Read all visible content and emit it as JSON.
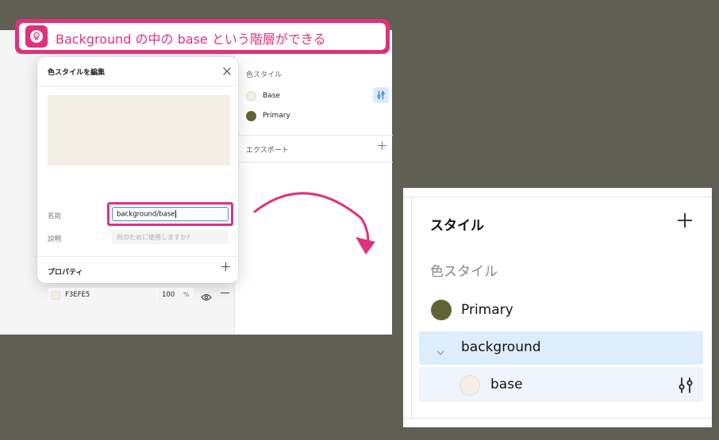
{
  "banner": {
    "text": "Background の中の base という階層ができる",
    "accent": "#e0317c",
    "icon": "lightbulb-icon"
  },
  "right_panel": {
    "section_title": "色スタイル",
    "styles": [
      {
        "label": "Base",
        "color": "#f3efe5"
      },
      {
        "label": "Primary",
        "color": "#626234"
      }
    ],
    "export_label": "エクスポート",
    "adjust_icon": "adjust-icon",
    "add_icon": "plus-icon"
  },
  "dialog": {
    "title": "色スタイルを編集",
    "close_icon": "close-icon",
    "preview_color": "#f3efe5",
    "name_label": "名前",
    "name_value": "background/base",
    "description_label": "説明",
    "description_placeholder": "何のために使用しますか?",
    "properties_title": "プロパティ",
    "property": {
      "hex": "F3EFE5",
      "opacity": "100",
      "percent_sign": "%",
      "visibility_icon": "eye-icon",
      "remove_icon": "minus-icon"
    },
    "add_icon": "plus-icon"
  },
  "zoom_panel": {
    "title": "スタイル",
    "subtitle": "色スタイル",
    "primary_label": "Primary",
    "primary_color": "#626234",
    "group_label": "background",
    "child_label": "base",
    "child_color": "#f3efe5",
    "group_bg": "#deedfb",
    "adjust_icon": "adjust-icon",
    "add_icon": "plus-icon",
    "chevron_icon": "chevron-down-icon"
  },
  "colors": {
    "background": "#5f5f53",
    "accent": "#e0317c",
    "focus": "#3a8eea"
  }
}
